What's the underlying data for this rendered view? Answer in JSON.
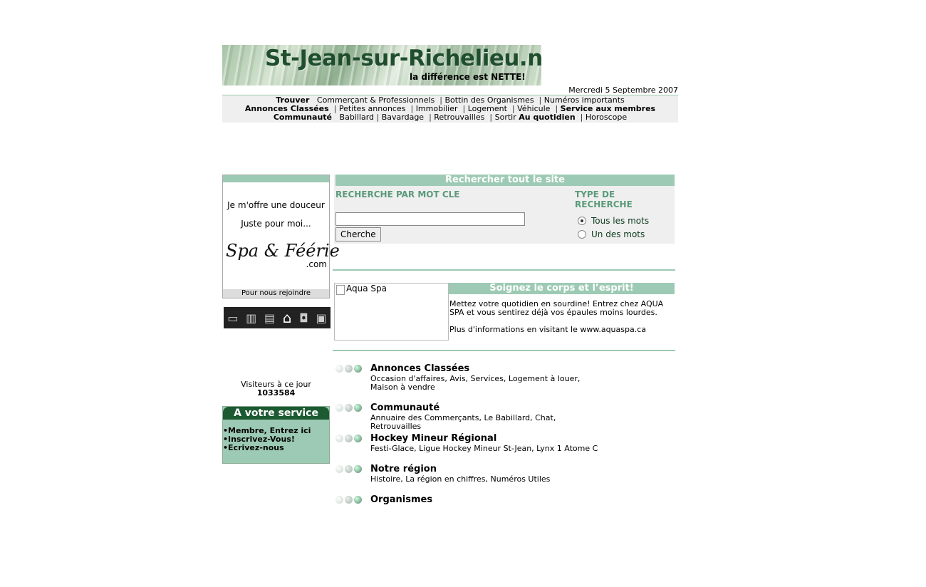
{
  "banner": {
    "title": "St-Jean-sur-Richelieu.net",
    "tagline": "la différence est NETTE!"
  },
  "date": "Mercredi 5 Septembre 2007",
  "nav": {
    "row1": {
      "label": "Trouver",
      "items": [
        "Commerçant & Professionnels",
        "Bottin des Organismes",
        "Numéros importants"
      ]
    },
    "row2": {
      "label": "Annonces Classées",
      "items": [
        "Petites annonces",
        "Immobilier",
        "Logement",
        "Véhicule"
      ],
      "label2": "Service aux membres"
    },
    "row3": {
      "label": "Communauté",
      "items": [
        "Babillard",
        "Bavardage",
        "Retrouvailles",
        "Sortir"
      ],
      "label2": "Au quotidien",
      "items2": [
        "Horoscope"
      ]
    }
  },
  "ad": {
    "line1": "Je m'offre une douceur",
    "line2": "Juste pour moi...",
    "logo": "Spa & Féérie",
    "dotcom": ".com",
    "join": "Pour nous rejoindre",
    "icons": [
      "window-icon",
      "book-icon",
      "film-icon",
      "building-icon",
      "save-icon",
      "image-icon"
    ]
  },
  "visitors": {
    "label": "Visiteurs à ce jour",
    "count": "1033584"
  },
  "service": {
    "title": "A votre service",
    "items": [
      "•Membre, Entrez ici",
      "•Inscrivez-Vous!",
      "•Ecrivez-nous"
    ]
  },
  "search": {
    "header": "Rechercher tout le site",
    "keyword_label": "RECHERCHE PAR MOT CLE",
    "type_label": "TYPE DE RECHERCHE",
    "input_value": "",
    "button": "Cherche",
    "options": [
      "Tous les mots",
      "Un des mots"
    ],
    "selected": "Tous les mots"
  },
  "feature": {
    "image_alt": "Aqua Spa",
    "header": "Soignez le corps et l’esprit!",
    "text1": "Mettez votre quotidien en sourdine! Entrez chez AQUA SPA et vous sentirez déjà vos épaules moins lourdes.",
    "text2": "Plus d'informations en visitant le www.aquaspa.ca"
  },
  "categories": [
    {
      "title": "Annonces Classées",
      "desc": "Occasion d'affaires, Avis, Services, Logement à louer, Maison à vendre"
    },
    {
      "title": "Communauté",
      "desc": "Annuaire des Commerçants, Le Babillard, Chat, Retrouvailles"
    },
    {
      "title": "Hockey Mineur Régional",
      "desc": "Festi-Glace, Ligue Hockey Mineur St-Jean, Lynx 1 Atome C"
    },
    {
      "title": "Notre région",
      "desc": "Histoire, La région en chiffres, Numéros Utiles"
    },
    {
      "title": "Organismes",
      "desc": ""
    }
  ],
  "colors": {
    "accent": "#9dcab4",
    "dark_green": "#1c5a32"
  }
}
